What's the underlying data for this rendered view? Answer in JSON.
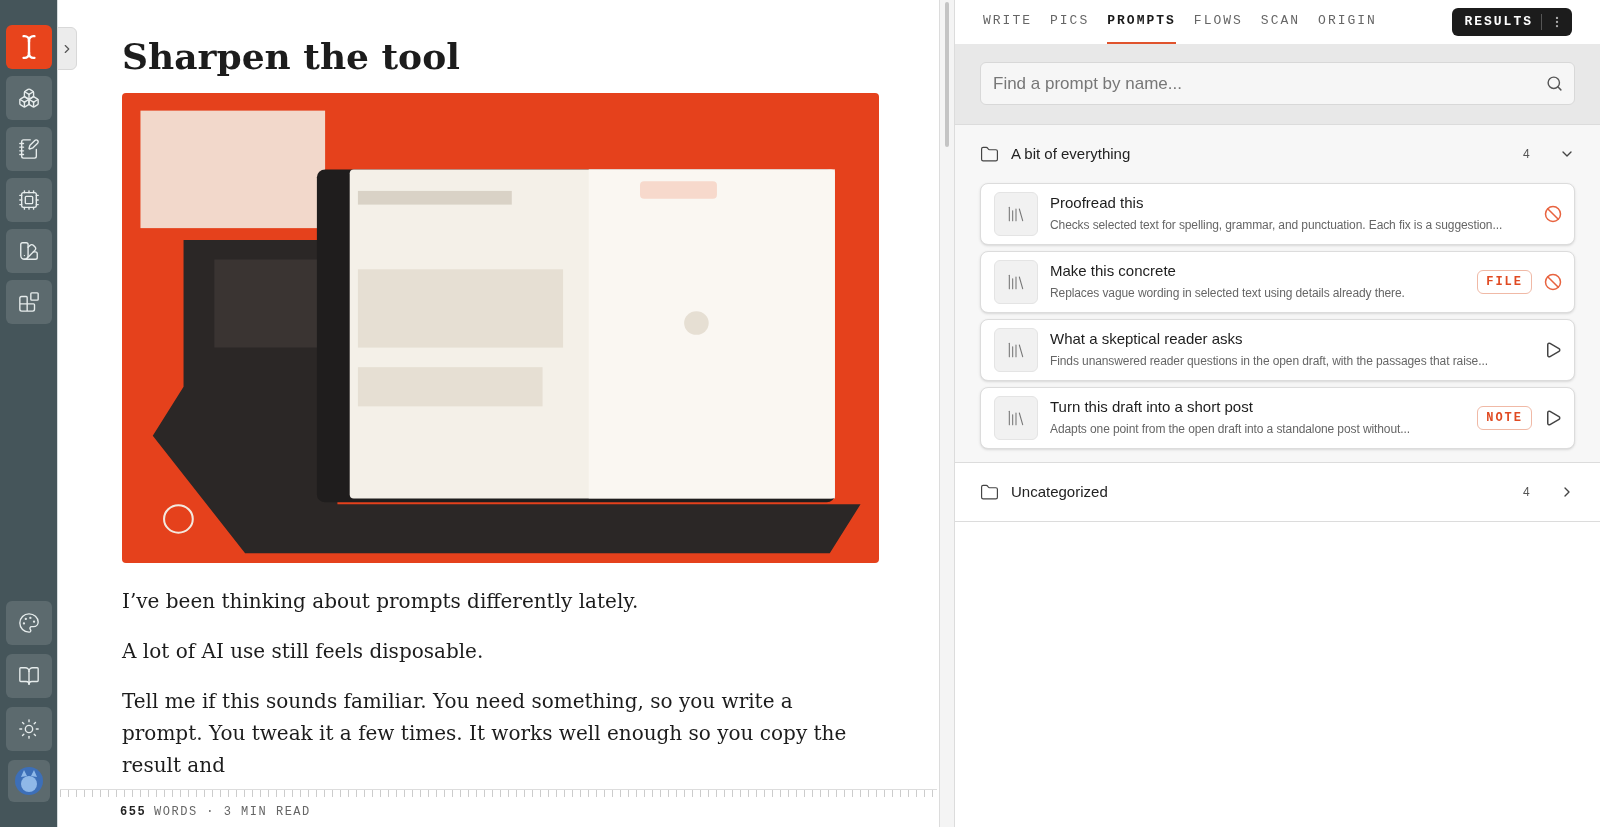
{
  "sidebar": {
    "items": [
      {
        "kind": "logo",
        "selected": true
      },
      {
        "kind": "blocks",
        "selected": false
      },
      {
        "kind": "notebook",
        "selected": false
      },
      {
        "kind": "chip",
        "selected": false
      },
      {
        "kind": "swatch",
        "selected": false
      },
      {
        "kind": "apps",
        "selected": false
      }
    ],
    "bottom": [
      {
        "kind": "palette"
      },
      {
        "kind": "book"
      },
      {
        "kind": "sun"
      },
      {
        "kind": "avatar"
      }
    ]
  },
  "document": {
    "title": "Sharpen the tool",
    "image": {
      "kind": "picture"
    },
    "paragraphs": [
      "I’ve been thinking about prompts differently lately.",
      "A lot of AI use still feels disposable.",
      "Tell me if this sounds familiar. You need something, so you write a prompt. You tweak it a few times. It works well enough so you copy the result and"
    ]
  },
  "status_bar": {
    "count": "655",
    "label": "WORDS · 3 MIN READ"
  },
  "tabs": [
    {
      "label": "WRITE",
      "selected": false
    },
    {
      "label": "PICS",
      "selected": false
    },
    {
      "label": "PROMPTS",
      "selected": true
    },
    {
      "label": "FLOWS",
      "selected": false
    },
    {
      "label": "SCAN",
      "selected": false
    },
    {
      "label": "ORIGIN",
      "selected": false
    }
  ],
  "results_button": "RESULTS",
  "search": {
    "placeholder": "Find a prompt by name..."
  },
  "groups": [
    {
      "name": "A bit of everything",
      "count": "4",
      "expanded": true,
      "prompts": [
        {
          "title": "Proofread this",
          "description": "Checks selected text for spelling, grammar, and punctuation. Each fix is a suggestion...",
          "kind": "blocked"
        },
        {
          "title": "Make this concrete",
          "description": "Replaces vague wording in selected text using details already there.",
          "badge": "FILE",
          "kind": "blocked"
        },
        {
          "title": "What a skeptical reader asks",
          "description": "Finds unanswered reader questions in the open draft, with the passages that raise...",
          "kind": "run"
        },
        {
          "title": "Turn this draft into a short post",
          "description": "Adapts one point from the open draft into a standalone post without...",
          "badge": "NOTE",
          "kind": "run"
        }
      ]
    },
    {
      "name": "Uncategorized",
      "count": "4",
      "expanded": false
    }
  ]
}
